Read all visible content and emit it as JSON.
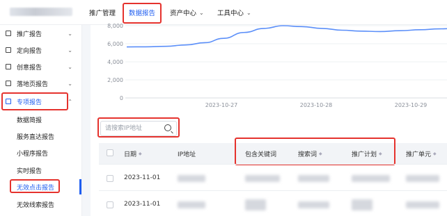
{
  "topnav": {
    "items": [
      {
        "label": "推广管理",
        "chevron": false
      },
      {
        "label": "数据报告",
        "chevron": false,
        "active": true
      },
      {
        "label": "资产中心",
        "chevron": true
      },
      {
        "label": "工具中心",
        "chevron": true
      }
    ]
  },
  "sidebar": {
    "items": [
      {
        "label": "推广报告",
        "icon": "grid-icon"
      },
      {
        "label": "定向报告",
        "icon": "target-icon"
      },
      {
        "label": "创意报告",
        "icon": "creative-icon"
      },
      {
        "label": "落地页报告",
        "icon": "page-icon"
      },
      {
        "label": "专项报告",
        "icon": "special-icon",
        "active": true
      }
    ],
    "sub_items": [
      "数据简报",
      "服务直达报告",
      "小程序报告",
      "实时报告",
      "无效点击报告",
      "无效线索报告"
    ],
    "active_sub": "无效点击报告"
  },
  "chart_data": {
    "type": "line",
    "x": [
      "2023-10-27",
      "2023-10-28",
      "2023-10-29"
    ],
    "y_ticks": [
      0,
      2000,
      4000,
      6000,
      8000
    ],
    "y_tick_labels": [
      "0",
      "2,000",
      "4,000",
      "6,000",
      "8,000"
    ],
    "series": [
      {
        "color": "#5b8ff9",
        "points": [
          [
            0,
            5650
          ],
          [
            0.12,
            5660
          ],
          [
            0.25,
            5720
          ],
          [
            0.38,
            5870
          ],
          [
            0.5,
            6120
          ],
          [
            0.62,
            6600
          ],
          [
            0.75,
            7250
          ],
          [
            0.88,
            7700
          ],
          [
            1.0,
            8000
          ],
          [
            1.12,
            7900
          ],
          [
            1.25,
            7700
          ],
          [
            1.38,
            7500
          ],
          [
            1.5,
            7400
          ],
          [
            1.62,
            7350
          ],
          [
            1.75,
            7450
          ],
          [
            1.88,
            7550
          ],
          [
            2.0,
            7650
          ],
          [
            2.12,
            7700
          ]
        ]
      }
    ],
    "ylim": [
      0,
      8000
    ],
    "grid": true
  },
  "search": {
    "placeholder": "请搜索IP地址"
  },
  "table": {
    "columns": [
      "日期",
      "IP地址",
      "包含关键词",
      "搜索词",
      "推广计划",
      "推广单元"
    ],
    "rows": [
      {
        "date": "2023-11-01"
      },
      {
        "date": "2023-11-01"
      }
    ]
  },
  "colors": {
    "accent": "#1f5ef0",
    "highlight": "#e5322d",
    "line": "#5b8ff9"
  }
}
